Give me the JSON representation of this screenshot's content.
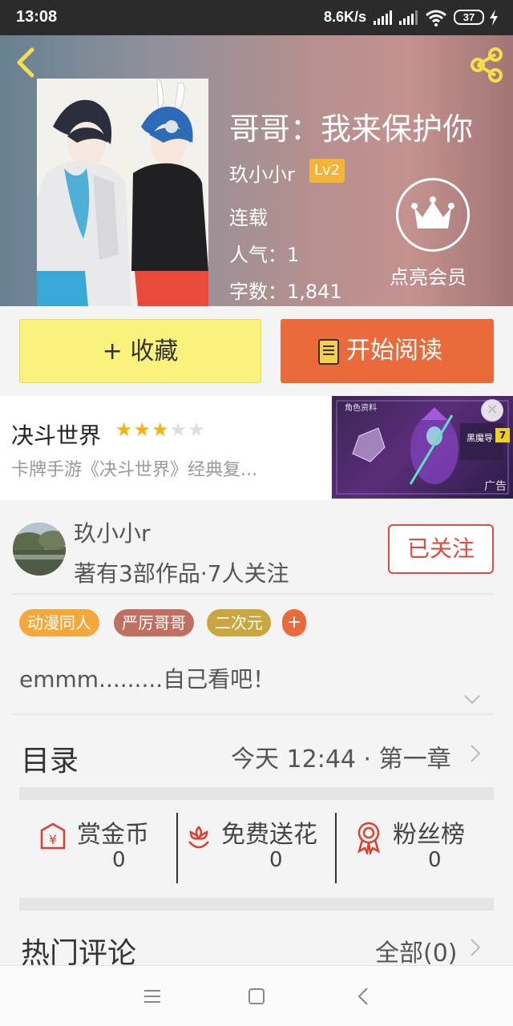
{
  "status_bar": {
    "time": "13:08",
    "network_speed": "8.6K/s",
    "battery_level": "37"
  },
  "book": {
    "title": "哥哥：我来保护你",
    "author": "玖小小r",
    "author_level": "Lv2",
    "status": "连载",
    "popularity": "人气：1",
    "word_count": "字数：1,841",
    "vip_label": "点亮会员"
  },
  "actions": {
    "favorite_label": "+ 收藏",
    "read_label": "开始阅读"
  },
  "ad": {
    "title": "决斗世界",
    "rating": 3,
    "rating_max": 5,
    "description": "卡牌手游《决斗世界》经典复...",
    "tag": "广告",
    "image_caption_top": "角色资料",
    "image_caption_name": "黑魔导",
    "image_caption_num": "7"
  },
  "author_info": {
    "name": "玖小小r",
    "stats": "著有3部作品·7人关注",
    "follow_label": "已关注"
  },
  "tags": [
    {
      "label": "动漫同人",
      "color": "#f5a83a"
    },
    {
      "label": "严厉哥哥",
      "color": "#bf7060"
    },
    {
      "label": "二次元",
      "color": "#c9a640"
    }
  ],
  "tag_add_label": "+",
  "description": "emmm.........自己看吧！",
  "toc": {
    "title": "目录",
    "latest": "今天 12:44 · 第一章"
  },
  "stats": [
    {
      "label": "赏金币",
      "value": "0",
      "icon": "reward-coin-icon"
    },
    {
      "label": "免费送花",
      "value": "0",
      "icon": "flower-icon"
    },
    {
      "label": "粉丝榜",
      "value": "0",
      "icon": "fan-rank-icon"
    }
  ],
  "comments": {
    "title": "热门评论",
    "all_label": "全部(0)"
  },
  "colors": {
    "accent_orange": "#eb6a3b",
    "favorite_yellow": "#faf27c",
    "follow_red": "#e04b3f",
    "level_badge": "#f5b437",
    "star": "#f5b30f"
  }
}
